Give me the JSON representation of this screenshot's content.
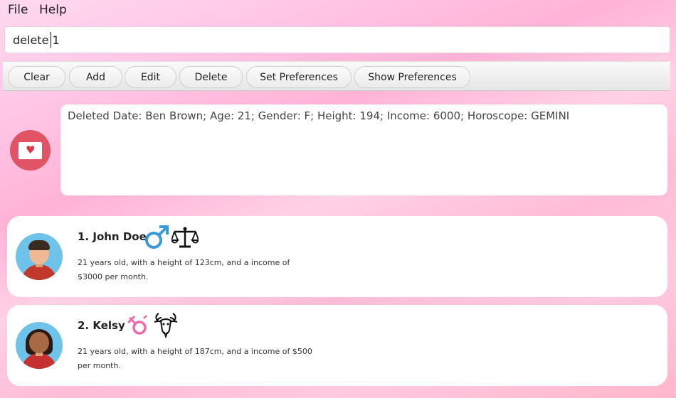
{
  "menu": {
    "file": "File",
    "help": "Help"
  },
  "command": {
    "value": "delete 1"
  },
  "toolbar": {
    "clear": "Clear",
    "add": "Add",
    "edit": "Edit",
    "delete": "Delete",
    "set_preferences": "Set Preferences",
    "show_preferences": "Show Preferences"
  },
  "result": {
    "text": "Deleted Date: Ben Brown; Age: 21; Gender: F; Height: 194; Income: 6000; Horoscope: GEMINI"
  },
  "dates": [
    {
      "title": "1.  John Doe",
      "description": "21 years old, with a height of 123cm, and a income of $3000 per month.",
      "gender_icon": "male-symbol-icon",
      "horoscope_icon": "libra-icon"
    },
    {
      "title": "2.  Kelsy",
      "description": "21 years old, with a height of 187cm, and a income of $500 per month.",
      "gender_icon": "female-symbol-icon",
      "horoscope_icon": "capricorn-goat-icon"
    }
  ],
  "colors": {
    "male": "#3a9ad9",
    "female": "#f06aa8",
    "message_avatar": "#e05466"
  }
}
